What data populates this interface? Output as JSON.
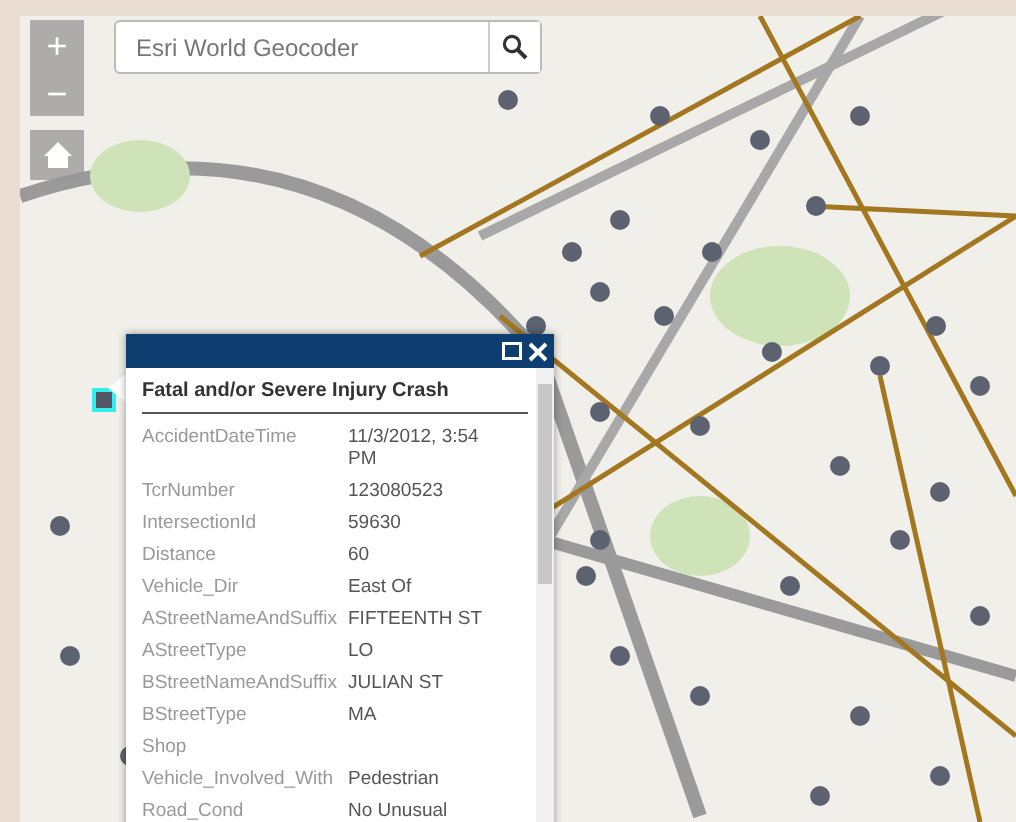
{
  "search": {
    "placeholder": "Esri World Geocoder"
  },
  "map_controls": [
    {
      "kind": "zoom-in",
      "label": "+"
    },
    {
      "kind": "zoom-out",
      "label": "−"
    },
    {
      "kind": "home"
    }
  ],
  "popup": {
    "title": "Fatal and/or Severe Injury Crash",
    "fields": [
      {
        "label": "AccidentDateTime",
        "value": "11/3/2012, 3:54 PM"
      },
      {
        "label": "TcrNumber",
        "value": "123080523"
      },
      {
        "label": "IntersectionId",
        "value": "59630"
      },
      {
        "label": "Distance",
        "value": "60"
      },
      {
        "label": "Vehicle_Dir",
        "value": "East Of"
      },
      {
        "label": "AStreetNameAndSuffix",
        "value": "FIFTEENTH ST"
      },
      {
        "label": "AStreetType",
        "value": "LO"
      },
      {
        "label": "BStreetNameAndSuffix",
        "value": "JULIAN ST"
      },
      {
        "label": "BStreetType",
        "value": "MA"
      },
      {
        "label": "Shop"
      },
      {
        "label": "Vehicle_Involved_With",
        "value": "Pedestrian"
      },
      {
        "label": "Road_Cond",
        "value": "No Unusual"
      }
    ]
  }
}
